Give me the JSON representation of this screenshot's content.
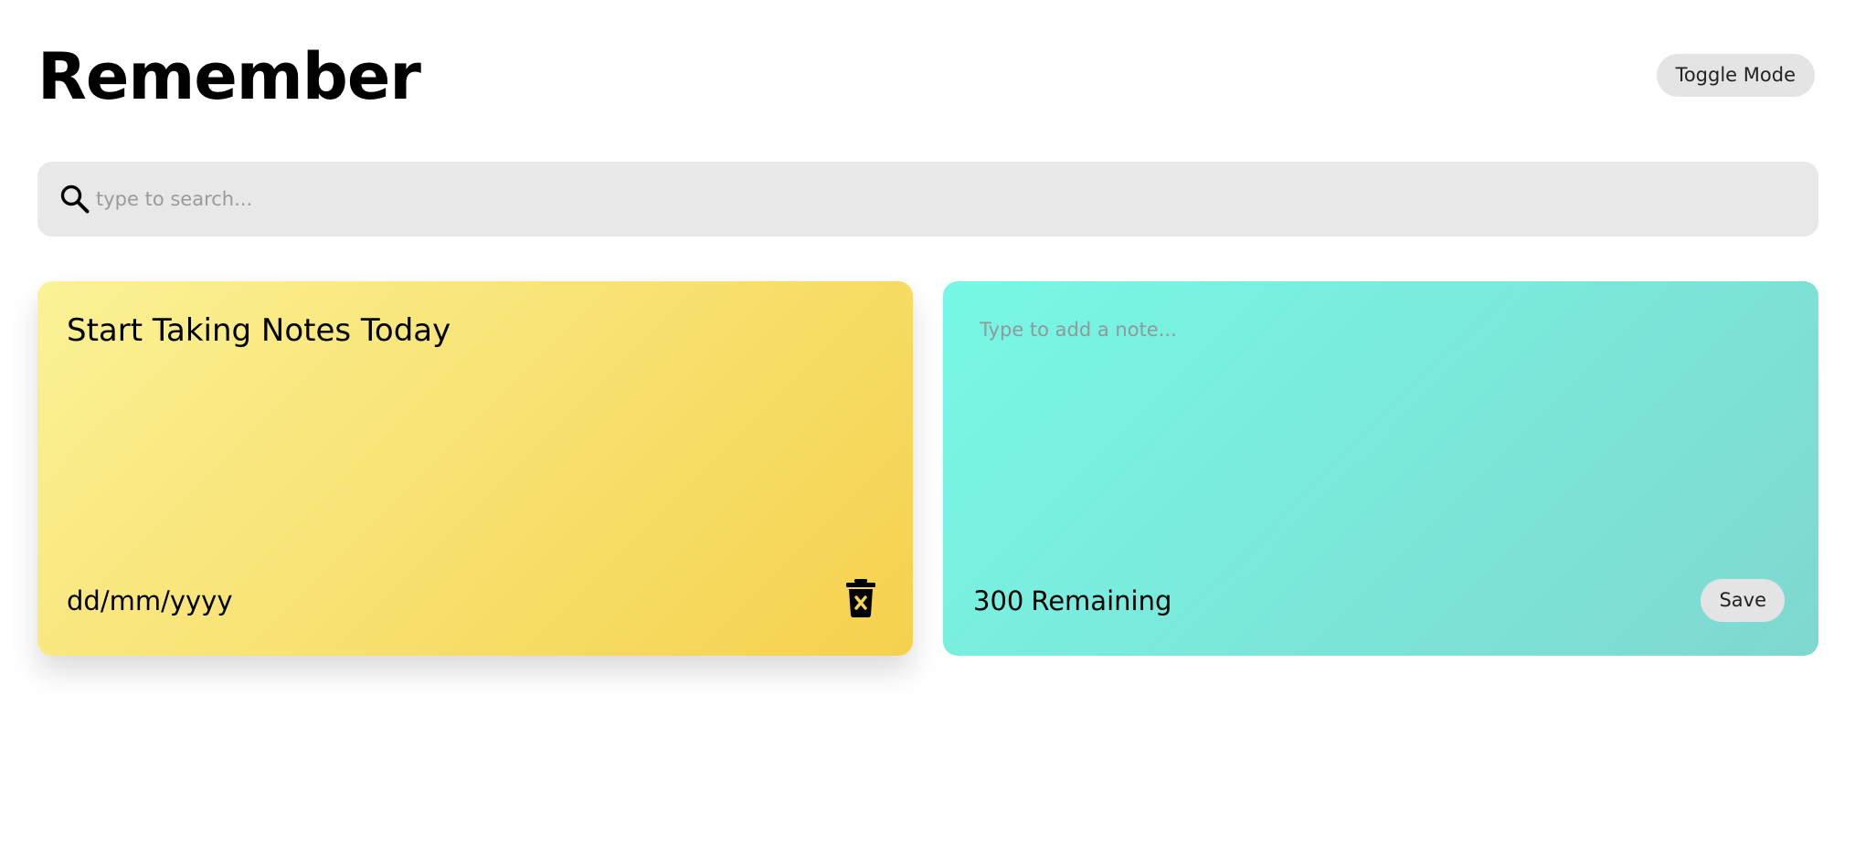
{
  "header": {
    "title": "Remember",
    "toggle_label": "Toggle Mode"
  },
  "search": {
    "icon": "search-icon",
    "placeholder": "type to search...",
    "value": ""
  },
  "notes": [
    {
      "text": "Start Taking Notes Today",
      "date": "dd/mm/yyyy",
      "delete_icon": "trash-delete-icon",
      "color_start": "#fbf296",
      "color_end": "#f5d14d"
    }
  ],
  "add_note": {
    "placeholder": "Type to add a note...",
    "value": "",
    "remaining_count": "300",
    "remaining_label": "Remaining",
    "save_label": "Save",
    "color_start": "#77f8e6",
    "color_end": "#7fd8cf"
  }
}
